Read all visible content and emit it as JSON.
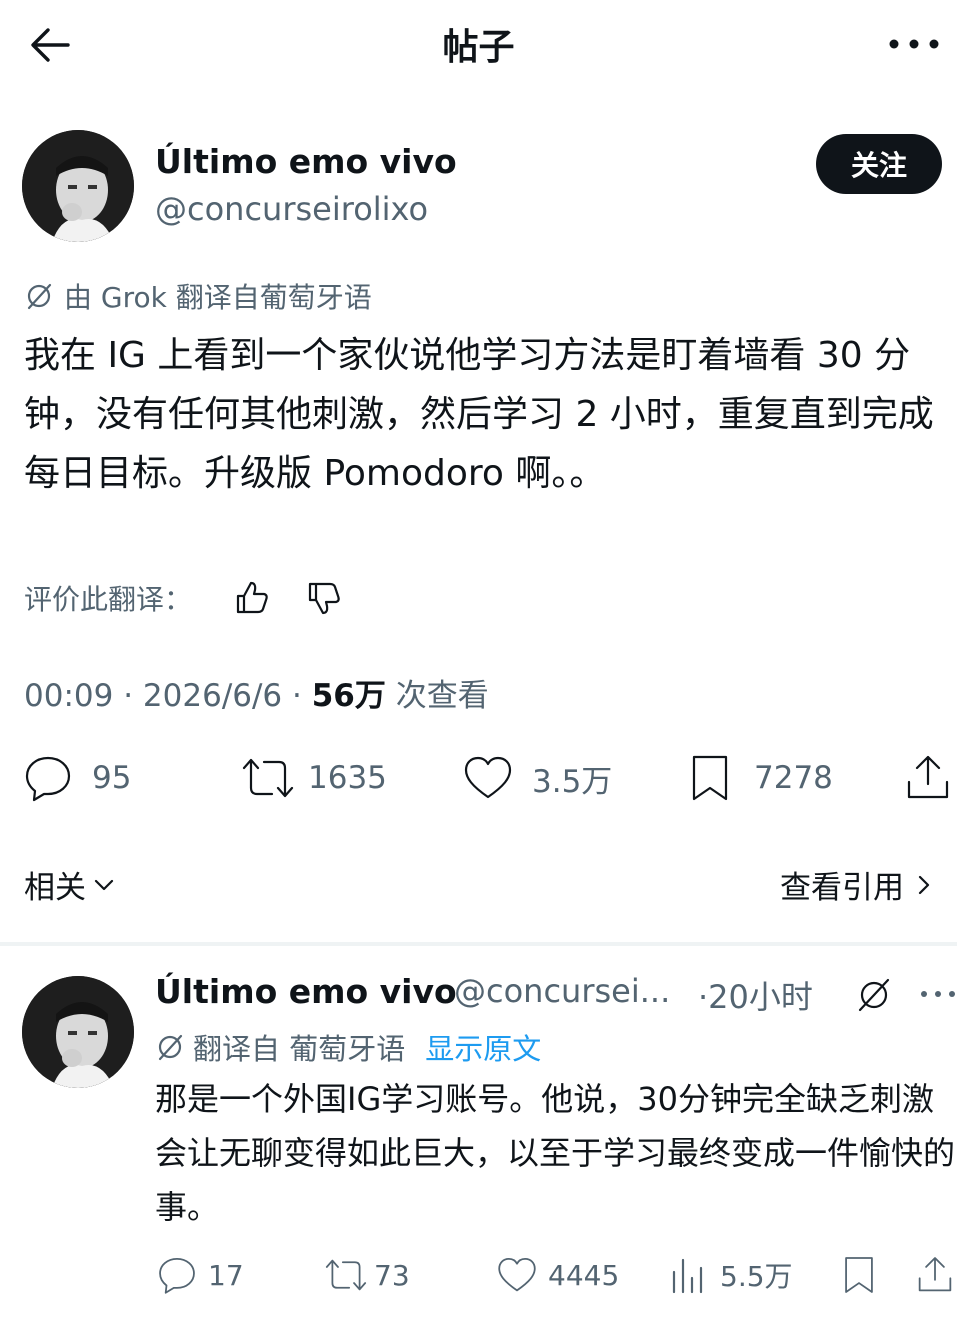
{
  "header": {
    "title": "帖子"
  },
  "post": {
    "display_name": "Último emo vivo",
    "handle": "@concurseirolixo",
    "follow_label": "关注",
    "translation_note": "由 Grok 翻译自葡萄牙语",
    "body": "我在 IG 上看到一个家伙说他学习方法是盯着墙看 30 分钟，没有任何其他刺激，然后学习 2 小时，重复直到完成每日目标。升级版 Pomodoro 啊。。",
    "rate_label": "评价此翻译：",
    "time": "00:09",
    "date": "2026/6/6",
    "views_count": "56万",
    "views_label": "次查看",
    "replies": "95",
    "reposts": "1635",
    "likes": "3.5万",
    "bookmarks": "7278"
  },
  "related": {
    "label": "相关",
    "quotes_label": "查看引用"
  },
  "reply": {
    "display_name": "Último emo vivo",
    "handle": "@concursei...",
    "time": "·20小时",
    "translated_from": "翻译自 葡萄牙语",
    "show_original": "显示原文",
    "body": "那是一个外国IG学习账号。他说，30分钟完全缺乏刺激会让无聊变得如此巨大，以至于学习最终变成一件愉快的事。",
    "replies": "17",
    "reposts": "73",
    "likes": "4445",
    "views": "5.5万"
  },
  "colors": {
    "link": "#1d9bf0",
    "muted": "#536471",
    "text": "#0f1419"
  }
}
